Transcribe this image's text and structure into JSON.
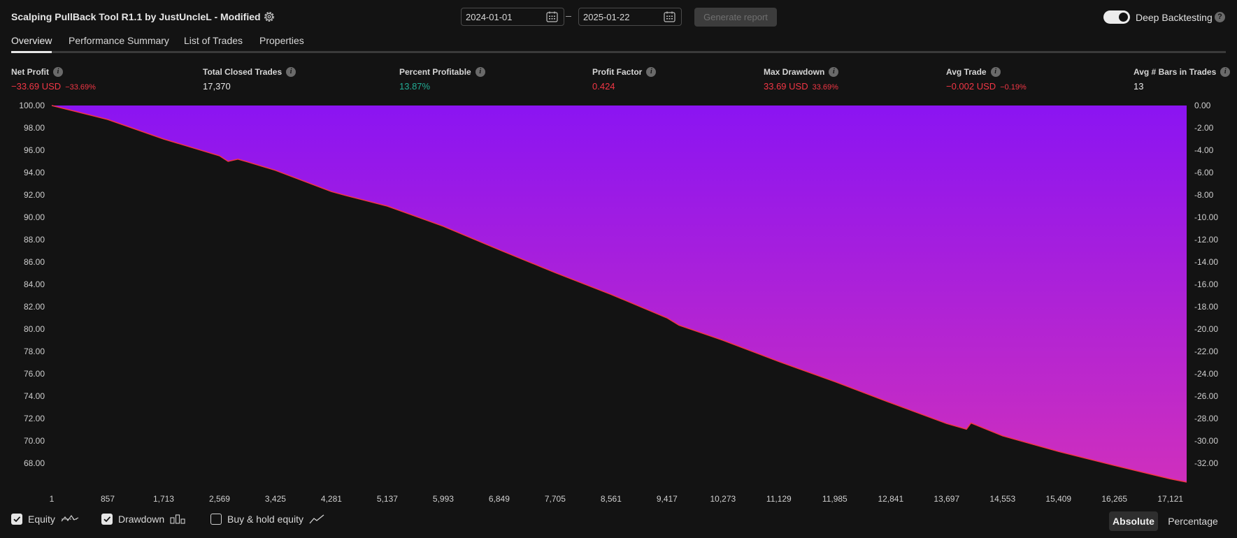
{
  "header": {
    "title": "Scalping PullBack Tool R1.1 by JustUncleL - Modified",
    "date_from": "2024-01-01",
    "date_to": "2025-01-22",
    "generate_label": "Generate report",
    "deep_backtesting_label": "Deep Backtesting",
    "deep_backtesting_on": true,
    "help_glyph": "?"
  },
  "tabs": [
    {
      "label": "Overview",
      "active": true
    },
    {
      "label": "Performance Summary",
      "active": false
    },
    {
      "label": "List of Trades",
      "active": false
    },
    {
      "label": "Properties",
      "active": false
    }
  ],
  "stats": [
    {
      "label": "Net Profit",
      "value": "−33.69 USD",
      "pct": "−33.69%",
      "color": "red"
    },
    {
      "label": "Total Closed Trades",
      "value": "17,370",
      "pct": "",
      "color": "white"
    },
    {
      "label": "Percent Profitable",
      "value": "13.87%",
      "pct": "",
      "color": "green"
    },
    {
      "label": "Profit Factor",
      "value": "0.424",
      "pct": "",
      "color": "red"
    },
    {
      "label": "Max Drawdown",
      "value": "33.69 USD",
      "pct": "33.69%",
      "color": "red"
    },
    {
      "label": "Avg Trade",
      "value": "−0.002 USD",
      "pct": "−0.19%",
      "color": "red"
    },
    {
      "label": "Avg # Bars in Trades",
      "value": "13",
      "pct": "",
      "color": "white"
    }
  ],
  "chart_data": {
    "type": "area",
    "series": [
      {
        "name": "Equity",
        "axis": "left",
        "color": "#f23645"
      },
      {
        "name": "Drawdown",
        "axis": "right",
        "color_top": "#8b14f2",
        "color_bottom": "#cf2fbd"
      }
    ],
    "x": [
      1,
      857,
      1713,
      2569,
      2700,
      2850,
      3000,
      3425,
      4281,
      4500,
      5137,
      5993,
      6849,
      7705,
      8561,
      9417,
      9600,
      10273,
      11129,
      11985,
      12841,
      13697,
      14000,
      14070,
      14553,
      15409,
      16265,
      17121,
      17370
    ],
    "equity": [
      100.0,
      98.75,
      97.0,
      95.5,
      95.0,
      95.2,
      94.95,
      94.2,
      92.3,
      91.95,
      91.0,
      89.2,
      87.1,
      85.05,
      83.1,
      81.0,
      80.35,
      79.0,
      77.1,
      75.3,
      73.4,
      71.55,
      71.05,
      71.6,
      70.45,
      69.05,
      67.8,
      66.6,
      66.31
    ],
    "drawdown": [
      0.0,
      -1.25,
      -3.0,
      -4.5,
      -5.0,
      -4.8,
      -5.05,
      -5.8,
      -7.7,
      -8.05,
      -9.0,
      -10.8,
      -12.9,
      -14.95,
      -16.9,
      -19.0,
      -19.65,
      -21.0,
      -22.9,
      -24.7,
      -26.6,
      -28.45,
      -28.95,
      -28.4,
      -29.55,
      -30.95,
      -32.2,
      -33.4,
      -33.69
    ],
    "x_ticks": [
      "1",
      "857",
      "1,713",
      "2,569",
      "3,425",
      "4,281",
      "5,137",
      "5,993",
      "6,849",
      "7,705",
      "8,561",
      "9,417",
      "10,273",
      "11,129",
      "11,985",
      "12,841",
      "13,697",
      "14,553",
      "15,409",
      "16,265",
      "17,121"
    ],
    "left_ticks": [
      "100.00",
      "98.00",
      "96.00",
      "94.00",
      "92.00",
      "90.00",
      "88.00",
      "86.00",
      "84.00",
      "82.00",
      "80.00",
      "78.00",
      "76.00",
      "74.00",
      "72.00",
      "70.00",
      "68.00"
    ],
    "right_ticks": [
      "0.00",
      "-2.00",
      "-4.00",
      "-6.00",
      "-8.00",
      "-10.00",
      "-12.00",
      "-14.00",
      "-16.00",
      "-18.00",
      "-20.00",
      "-22.00",
      "-24.00",
      "-26.00",
      "-28.00",
      "-30.00",
      "-32.00"
    ],
    "left_range": [
      66.31,
      100
    ],
    "right_range": [
      -33.69,
      0
    ],
    "x_range": [
      1,
      17370
    ]
  },
  "legend": {
    "equity_label": "Equity",
    "equity_checked": true,
    "drawdown_label": "Drawdown",
    "drawdown_checked": true,
    "buyhold_label": "Buy & hold equity",
    "buyhold_checked": false
  },
  "view_toggle": {
    "absolute_label": "Absolute",
    "percentage_label": "Percentage",
    "selected": "Absolute"
  }
}
